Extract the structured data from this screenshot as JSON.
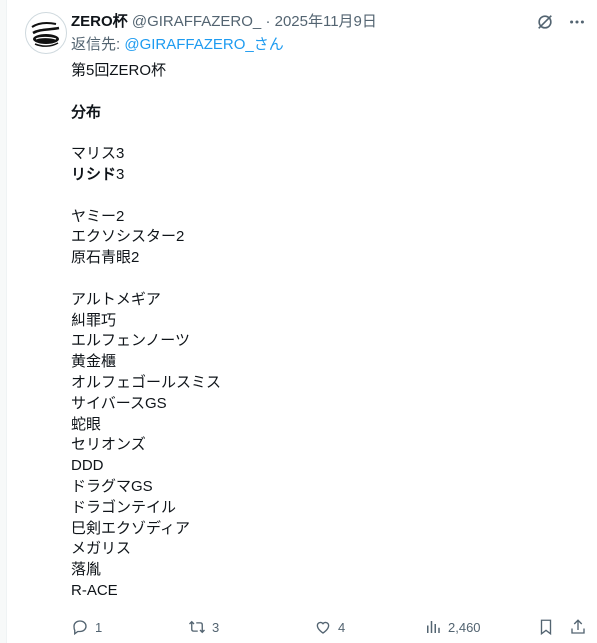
{
  "tweet": {
    "display_name": "ZERO杯",
    "handle": "@GIRAFFAZERO_",
    "separator": "·",
    "date": "2025年11月9日",
    "replying_prefix": "返信先:",
    "replying_handle": "@GIRAFFAZERO_",
    "replying_suffix": "さん",
    "body": {
      "title": "第5回ZERO杯",
      "heading": "分布",
      "tier3": [
        {
          "name": "マリス",
          "count": "3"
        },
        {
          "name": "リシド",
          "count": "3"
        }
      ],
      "tier2": [
        "ヤミー2",
        "エクソシスター2",
        "原石青眼2"
      ],
      "tier1": [
        "アルトメギア",
        "糾罪巧",
        "エルフェンノーツ",
        "黄金櫃",
        "オルフェゴールスミス",
        "サイバースGS",
        "蛇眼",
        "セリオンズ",
        "DDD",
        "ドラグマGS",
        "ドラゴンテイル",
        "巳剣エクゾディア",
        "メガリス",
        "落胤",
        "R-ACE"
      ]
    },
    "stats": {
      "replies": "1",
      "reposts": "3",
      "likes": "4",
      "views": "2,460"
    }
  }
}
